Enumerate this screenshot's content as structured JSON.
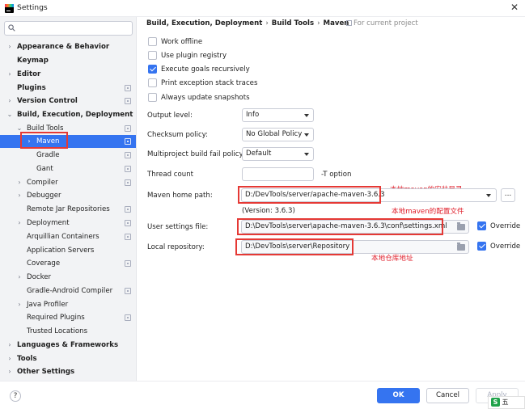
{
  "window": {
    "title": "Settings",
    "close_glyph": "✕"
  },
  "search": {
    "placeholder": "",
    "icon": "search-icon"
  },
  "sidebar": {
    "items": [
      {
        "label": "Appearance & Behavior",
        "expanded": false,
        "bold": true
      },
      {
        "label": "Keymap",
        "bold": true
      },
      {
        "label": "Editor",
        "expanded": false,
        "bold": true
      },
      {
        "label": "Plugins",
        "bold": true
      },
      {
        "label": "Version Control",
        "expanded": false,
        "bold": true
      },
      {
        "label": "Build, Execution, Deployment",
        "expanded": true,
        "bold": true
      },
      {
        "label": "Build Tools",
        "expanded": true
      },
      {
        "label": "Maven",
        "expanded": false,
        "selected": true
      },
      {
        "label": "Gradle"
      },
      {
        "label": "Gant"
      },
      {
        "label": "Compiler",
        "expanded": false
      },
      {
        "label": "Debugger",
        "expanded": false
      },
      {
        "label": "Remote Jar Repositories"
      },
      {
        "label": "Deployment",
        "expanded": false
      },
      {
        "label": "Arquillian Containers"
      },
      {
        "label": "Application Servers"
      },
      {
        "label": "Coverage"
      },
      {
        "label": "Docker",
        "expanded": false
      },
      {
        "label": "Gradle-Android Compiler"
      },
      {
        "label": "Java Profiler",
        "expanded": false
      },
      {
        "label": "Required Plugins"
      },
      {
        "label": "Trusted Locations"
      },
      {
        "label": "Languages & Frameworks",
        "expanded": false,
        "bold": true
      },
      {
        "label": "Tools",
        "expanded": false,
        "bold": true
      },
      {
        "label": "Other Settings",
        "expanded": false,
        "bold": true
      }
    ]
  },
  "breadcrumb": {
    "items": [
      "Build, Execution, Deployment",
      "Build Tools",
      "Maven"
    ],
    "separator": "›",
    "scope": "For current project"
  },
  "options": {
    "work_offline": {
      "label": "Work offline",
      "checked": false
    },
    "use_plugin_registry": {
      "label": "Use plugin registry",
      "checked": false
    },
    "execute_goals_recursively": {
      "label": "Execute goals recursively",
      "checked": true
    },
    "print_exception_stack_traces": {
      "label": "Print exception stack traces",
      "checked": false
    },
    "always_update_snapshots": {
      "label": "Always update snapshots",
      "checked": false
    }
  },
  "form": {
    "output_level": {
      "label": "Output level:",
      "value": "Info"
    },
    "checksum_policy": {
      "label": "Checksum policy:",
      "value": "No Global Policy"
    },
    "multiproject_fail_policy": {
      "label": "Multiproject build fail policy:",
      "value": "Default"
    },
    "thread_count": {
      "label": "Thread count",
      "value": "",
      "hint": "-T option"
    },
    "maven_home": {
      "label": "Maven home path:",
      "value": "D:/DevTools/server/apache-maven-3.6.3",
      "version": "(Version: 3.6.3)",
      "browse": "..."
    },
    "user_settings": {
      "label": "User settings file:",
      "value": "D:\\DevTools\\server\\apache-maven-3.6.3\\conf\\settings.xml",
      "override_label": "Override",
      "override": true
    },
    "local_repository": {
      "label": "Local repository:",
      "value": "D:\\DevTools\\server\\Repository",
      "override_label": "Override",
      "override": true
    }
  },
  "annotations": {
    "maven_home_note": "本地maven的安装目录",
    "settings_note": "本地maven的配置文件",
    "repository_note": "本地仓库地址",
    "highlight_color": "#e53935"
  },
  "footer": {
    "help": "?",
    "ok": "OK",
    "cancel": "Cancel",
    "apply": "Apply",
    "ime_text": "五"
  },
  "colors": {
    "accent": "#3574f0",
    "sidebar_bg": "#f2f3f5",
    "annotation": "#e0202c"
  }
}
